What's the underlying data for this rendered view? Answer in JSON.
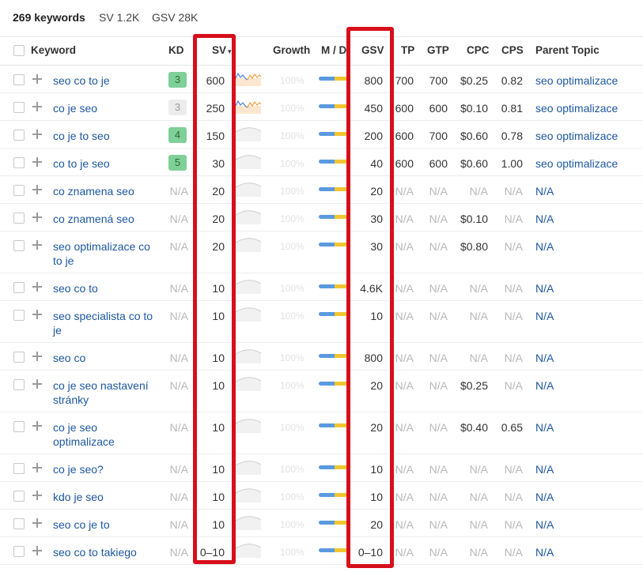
{
  "summary": {
    "keywords": "269 keywords",
    "sv": "SV 1.2K",
    "gsv": "GSV 28K"
  },
  "columns": {
    "keyword": "Keyword",
    "kd": "KD",
    "sv": "SV",
    "growth": "Growth",
    "md": "M / D",
    "gsv": "GSV",
    "tp": "TP",
    "gtp": "GTP",
    "cpc": "CPC",
    "cps": "CPS",
    "parent": "Parent Topic"
  },
  "colors": {
    "link": "#1d57a0",
    "kd_green": "#7fcf98",
    "kd_gray": "#ececec",
    "highlight": "#d70f1b",
    "md_blue": "#5a9ae0",
    "md_yellow": "#f2c530"
  },
  "rows": [
    {
      "keyword": "seo co to je",
      "kd": "3",
      "kd_style": "green",
      "sv": "600",
      "growth": "100%",
      "gsv": "800",
      "tp": "700",
      "gtp": "700",
      "cpc": "$0.25",
      "cps": "0.82",
      "parent": "seo optimalizace",
      "lines": 1,
      "spark": "chart"
    },
    {
      "keyword": "co je seo",
      "kd": "3",
      "kd_style": "gray",
      "sv": "250",
      "growth": "100%",
      "gsv": "450",
      "tp": "600",
      "gtp": "600",
      "cpc": "$0.10",
      "cps": "0.81",
      "parent": "seo optimalizace",
      "lines": 1,
      "spark": "chart"
    },
    {
      "keyword": "co je to seo",
      "kd": "4",
      "kd_style": "green",
      "sv": "150",
      "growth": "100%",
      "gsv": "200",
      "tp": "600",
      "gtp": "700",
      "cpc": "$0.60",
      "cps": "0.78",
      "parent": "seo optimalizace",
      "lines": 1,
      "spark": "flat"
    },
    {
      "keyword": "co to je seo",
      "kd": "5",
      "kd_style": "green",
      "sv": "30",
      "growth": "100%",
      "gsv": "40",
      "tp": "600",
      "gtp": "600",
      "cpc": "$0.60",
      "cps": "1.00",
      "parent": "seo optimalizace",
      "lines": 1,
      "spark": "flat"
    },
    {
      "keyword": "co znamena seo",
      "kd": "N/A",
      "sv": "20",
      "growth": "100%",
      "gsv": "20",
      "tp": "N/A",
      "gtp": "N/A",
      "cpc": "N/A",
      "cps": "N/A",
      "parent": "N/A",
      "lines": 1,
      "spark": "flat"
    },
    {
      "keyword": "co znamená seo",
      "kd": "N/A",
      "sv": "20",
      "growth": "100%",
      "gsv": "30",
      "tp": "N/A",
      "gtp": "N/A",
      "cpc": "$0.10",
      "cps": "N/A",
      "parent": "N/A",
      "lines": 1,
      "spark": "flat"
    },
    {
      "keyword": "seo optimalizace co to je",
      "kd": "N/A",
      "sv": "20",
      "growth": "100%",
      "gsv": "30",
      "tp": "N/A",
      "gtp": "N/A",
      "cpc": "$0.80",
      "cps": "N/A",
      "parent": "N/A",
      "lines": 2,
      "spark": "flat"
    },
    {
      "keyword": "seo co to",
      "kd": "N/A",
      "sv": "10",
      "growth": "100%",
      "gsv": "4.6K",
      "tp": "N/A",
      "gtp": "N/A",
      "cpc": "N/A",
      "cps": "N/A",
      "parent": "N/A",
      "lines": 1,
      "spark": "flat"
    },
    {
      "keyword": "seo specialista co to je",
      "kd": "N/A",
      "sv": "10",
      "growth": "100%",
      "gsv": "10",
      "tp": "N/A",
      "gtp": "N/A",
      "cpc": "N/A",
      "cps": "N/A",
      "parent": "N/A",
      "lines": 2,
      "spark": "flat"
    },
    {
      "keyword": "seo co",
      "kd": "N/A",
      "sv": "10",
      "growth": "100%",
      "gsv": "800",
      "tp": "N/A",
      "gtp": "N/A",
      "cpc": "N/A",
      "cps": "N/A",
      "parent": "N/A",
      "lines": 1,
      "spark": "flat"
    },
    {
      "keyword": "co je seo nastavení stránky",
      "kd": "N/A",
      "sv": "10",
      "growth": "100%",
      "gsv": "20",
      "tp": "N/A",
      "gtp": "N/A",
      "cpc": "$0.25",
      "cps": "N/A",
      "parent": "N/A",
      "lines": 2,
      "spark": "flat"
    },
    {
      "keyword": "co je seo optimalizace",
      "kd": "N/A",
      "sv": "10",
      "growth": "100%",
      "gsv": "20",
      "tp": "N/A",
      "gtp": "N/A",
      "cpc": "$0.40",
      "cps": "0.65",
      "parent": "N/A",
      "lines": 2,
      "spark": "flat"
    },
    {
      "keyword": "co je seo?",
      "kd": "N/A",
      "sv": "10",
      "growth": "100%",
      "gsv": "10",
      "tp": "N/A",
      "gtp": "N/A",
      "cpc": "N/A",
      "cps": "N/A",
      "parent": "N/A",
      "lines": 1,
      "spark": "flat"
    },
    {
      "keyword": "kdo je seo",
      "kd": "N/A",
      "sv": "10",
      "growth": "100%",
      "gsv": "10",
      "tp": "N/A",
      "gtp": "N/A",
      "cpc": "N/A",
      "cps": "N/A",
      "parent": "N/A",
      "lines": 1,
      "spark": "flat"
    },
    {
      "keyword": "seo co je to",
      "kd": "N/A",
      "sv": "10",
      "growth": "100%",
      "gsv": "20",
      "tp": "N/A",
      "gtp": "N/A",
      "cpc": "N/A",
      "cps": "N/A",
      "parent": "N/A",
      "lines": 1,
      "spark": "flat"
    },
    {
      "keyword": "seo co to takiego",
      "kd": "N/A",
      "sv": "0–10",
      "growth": "100%",
      "gsv": "0–10",
      "tp": "N/A",
      "gtp": "N/A",
      "cpc": "N/A",
      "cps": "N/A",
      "parent": "N/A",
      "lines": 1,
      "spark": "flat"
    }
  ]
}
